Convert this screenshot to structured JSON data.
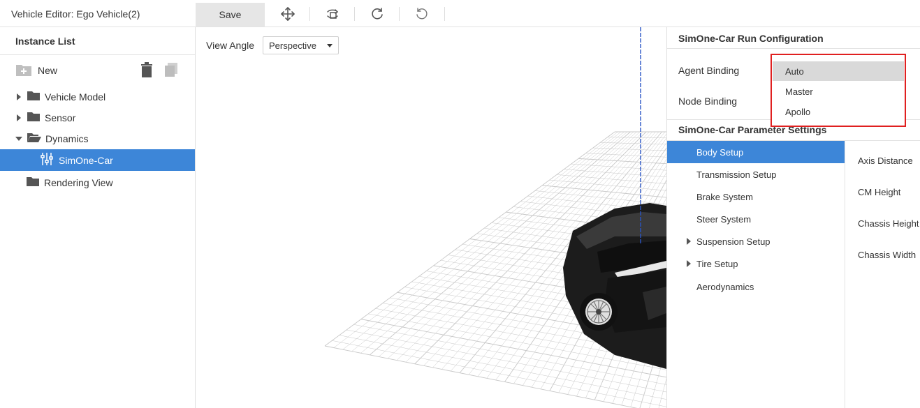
{
  "header": {
    "title": "Vehicle Editor: Ego Vehicle(2)",
    "save_label": "Save",
    "tools": [
      "move-icon",
      "rotate-view-icon",
      "redo-icon",
      "reset-icon"
    ]
  },
  "instance_list": {
    "title": "Instance List",
    "new_label": "New",
    "items": [
      {
        "label": "Vehicle Model",
        "icon": "folder-icon",
        "expanded": false
      },
      {
        "label": "Sensor",
        "icon": "folder-icon",
        "expanded": false
      },
      {
        "label": "Dynamics",
        "icon": "folder-open-icon",
        "expanded": true
      },
      {
        "label": "SimOne-Car",
        "icon": "sliders-icon",
        "selected": true
      },
      {
        "label": "Rendering View",
        "icon": "folder-icon"
      }
    ]
  },
  "viewport": {
    "view_angle_label": "View Angle",
    "view_angle_value": "Perspective"
  },
  "run_config": {
    "title": "SimOne-Car Run Configuration",
    "agent_binding_label": "Agent Binding",
    "node_binding_label": "Node Binding",
    "dropdown_options": [
      "Auto",
      "Master",
      "Apollo"
    ],
    "highlighted_option": "Auto"
  },
  "parameter_settings": {
    "title": "SimOne-Car Parameter Settings",
    "menu": [
      {
        "label": "Body Setup",
        "active": true
      },
      {
        "label": "Transmission Setup"
      },
      {
        "label": "Brake System"
      },
      {
        "label": "Steer System"
      },
      {
        "label": "Suspension Setup",
        "expandable": true
      },
      {
        "label": "Tire Setup",
        "expandable": true
      },
      {
        "label": "Aerodynamics"
      }
    ],
    "params": [
      "Axis Distance",
      "CM Height",
      "Chassis Height",
      "Chassis Width"
    ]
  },
  "colors": {
    "selection": "#3d86d8",
    "highlight_box": "#e02020",
    "grid": "#c8c8c8"
  }
}
